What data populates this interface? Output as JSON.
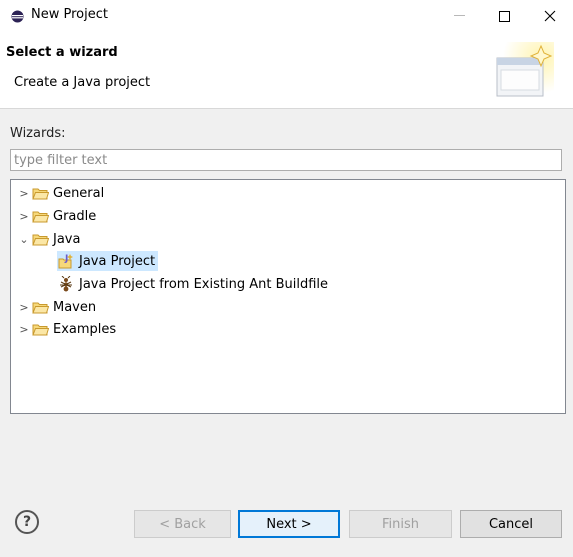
{
  "window": {
    "title": "New Project"
  },
  "banner": {
    "title": "Select a wizard",
    "description": "Create a Java project"
  },
  "wizards": {
    "label": "Wizards:",
    "filter_placeholder": "type filter text",
    "tree": [
      {
        "label": "General",
        "expanded": false,
        "icon": "folder-icon"
      },
      {
        "label": "Gradle",
        "expanded": false,
        "icon": "folder-icon"
      },
      {
        "label": "Java",
        "expanded": true,
        "icon": "folder-icon",
        "children": [
          {
            "label": "Java Project",
            "selected": true,
            "icon": "java-project-icon"
          },
          {
            "label": "Java Project from Existing Ant Buildfile",
            "icon": "ant-icon"
          }
        ]
      },
      {
        "label": "Maven",
        "expanded": false,
        "icon": "folder-icon"
      },
      {
        "label": "Examples",
        "expanded": false,
        "icon": "folder-icon"
      }
    ]
  },
  "buttons": {
    "help": "?",
    "back": "< Back",
    "next": "Next >",
    "finish": "Finish",
    "cancel": "Cancel"
  },
  "colors": {
    "selection": "#cde8ff",
    "primary_border": "#0078d7",
    "folder": "#e8c35a"
  }
}
